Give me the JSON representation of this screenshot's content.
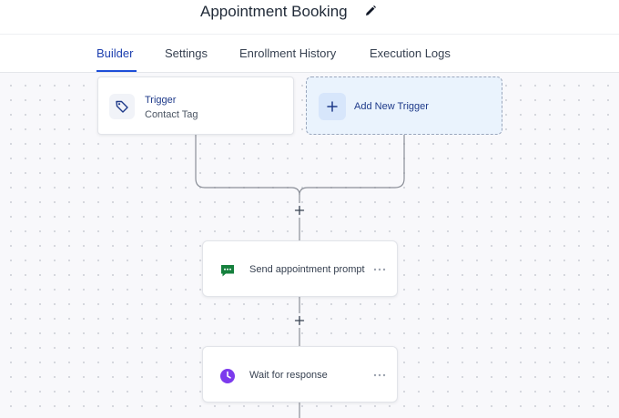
{
  "header": {
    "title": "Appointment Booking",
    "edit_icon": "pencil-icon"
  },
  "tabs": [
    {
      "label": "Builder",
      "active": true
    },
    {
      "label": "Settings",
      "active": false
    },
    {
      "label": "Enrollment History",
      "active": false
    },
    {
      "label": "Execution Logs",
      "active": false
    }
  ],
  "trigger": {
    "title": "Trigger",
    "subtitle": "Contact Tag",
    "icon": "tag-icon"
  },
  "add_trigger": {
    "label": "Add New Trigger",
    "icon": "plus-icon"
  },
  "actions": [
    {
      "label": "Send appointment prompt",
      "icon": "message-icon",
      "icon_color": "#15803d"
    },
    {
      "label": "Wait for response",
      "icon": "clock-icon",
      "icon_color": "#7c3aed"
    }
  ],
  "colors": {
    "accent": "#1d4ed8",
    "add_trigger_bg": "#eaf3fd",
    "message_icon": "#15803d",
    "clock_icon": "#7c3aed"
  }
}
